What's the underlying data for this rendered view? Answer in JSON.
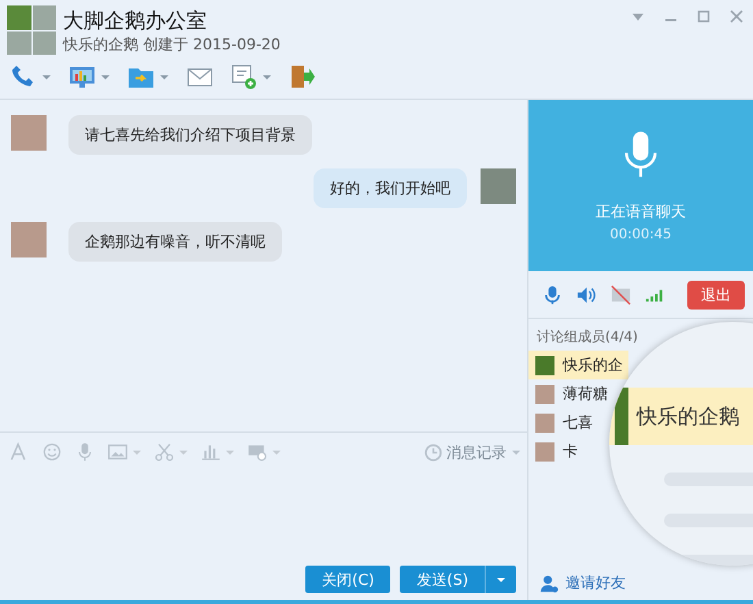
{
  "window": {
    "title": "大脚企鹅办公室",
    "subtitle": "快乐的企鹅 创建于 2015-09-20"
  },
  "toolbar": [
    {
      "kind": "phone",
      "dropdown": true
    },
    {
      "kind": "screen",
      "dropdown": true
    },
    {
      "kind": "folder",
      "dropdown": true
    },
    {
      "kind": "mail",
      "dropdown": false
    },
    {
      "kind": "note",
      "dropdown": true
    },
    {
      "kind": "exit",
      "dropdown": false
    }
  ],
  "messages": [
    {
      "text": "请七喜先给我们介绍下项目背景",
      "outgoing": false
    },
    {
      "text": "好的，我们开始吧",
      "outgoing": true
    },
    {
      "text": "企鹅那边有噪音，听不清呢",
      "outgoing": false
    }
  ],
  "input_toolbar": [
    {
      "kind": "font",
      "dropdown": false
    },
    {
      "kind": "emoji",
      "dropdown": false
    },
    {
      "kind": "mic",
      "dropdown": false
    },
    {
      "kind": "image",
      "dropdown": true
    },
    {
      "kind": "scissors",
      "dropdown": true
    },
    {
      "kind": "chart",
      "dropdown": true
    },
    {
      "kind": "tag",
      "dropdown": true
    }
  ],
  "history": "消息记录",
  "buttons": {
    "close": "关闭(C)",
    "send": "发送(S)"
  },
  "call": {
    "status": "正在语音聊天",
    "time": "00:00:45",
    "camera_on": false,
    "exit": "退出"
  },
  "members": {
    "title": "讨论组成员(4/4)",
    "items": [
      {
        "name": "快乐的企",
        "selected": true
      },
      {
        "name": "薄荷糖",
        "selected": false
      },
      {
        "name": "七喜",
        "selected": false
      },
      {
        "name": "卡",
        "selected": false
      }
    ]
  },
  "magnifier": {
    "name": "快乐的企鹅"
  },
  "invite": "邀请好友"
}
